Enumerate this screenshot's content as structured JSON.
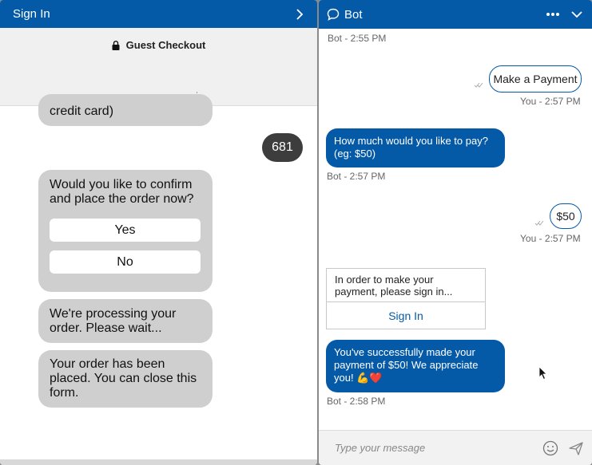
{
  "left": {
    "header_title": "Sign In",
    "guest_title": "Guest Checkout",
    "messages": {
      "credit": "credit card)",
      "amount": "681",
      "confirm": "Would you like to confirm and place the order now?",
      "yes": "Yes",
      "no": "No",
      "processing": "We're processing your order. Please wait...",
      "placed": "Your order has been placed. You can close this form."
    }
  },
  "right": {
    "header_title": "Bot",
    "chat": {
      "ts1": "Bot - 2:55 PM",
      "user_msg1": "Make a Payment",
      "ts2": "You - 2:57 PM",
      "bot_msg1": "How much would you like to pay? (eg: $50)",
      "ts3": "Bot - 2:57 PM",
      "user_msg2": "$50",
      "ts4": "You - 2:57 PM",
      "card_text": "In order to make your payment, please sign in...",
      "card_button": "Sign In",
      "bot_msg2": "You've successfully made your payment of $50! We appreciate you! 💪❤️",
      "ts5": "Bot - 2:58 PM"
    },
    "composer": {
      "placeholder": "Type your message"
    }
  },
  "colors": {
    "brand": "#055aa8",
    "bubble_gray": "#cfcfcf",
    "dark_bubble": "#3d3d3d"
  },
  "icons": [
    "chevron-right-icon",
    "lock-icon",
    "chat-icon",
    "more-icon",
    "chevron-down-icon",
    "emoji-icon",
    "send-icon",
    "read-tick-icon",
    "cursor-icon"
  ]
}
